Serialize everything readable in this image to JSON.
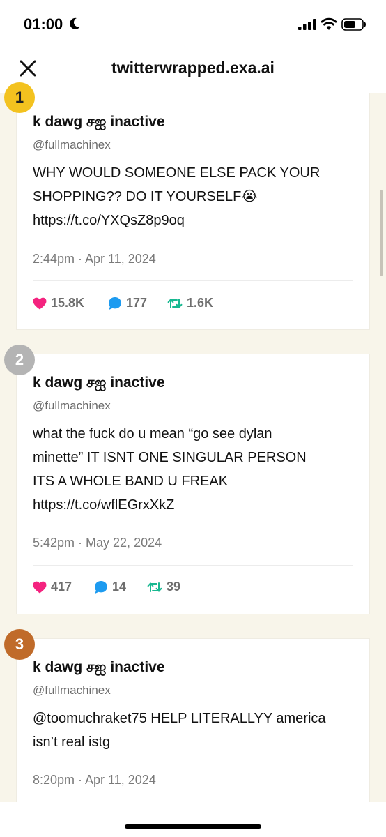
{
  "status_bar": {
    "time": "01:00"
  },
  "header": {
    "title": "twitterwrapped.exa.ai"
  },
  "tweets": [
    {
      "rank": "1",
      "name": "k dawg சஐ inactive",
      "handle": "@fullmachinex",
      "lines": [
        "WHY WOULD SOMEONE ELSE PACK YOUR",
        "SHOPPING?? DO IT YOURSELF😭",
        "https://t.co/YXQsZ8p9oq"
      ],
      "timestamp": "2:44pm · Apr 11, 2024",
      "likes": "15.8K",
      "replies": "177",
      "retweets": "1.6K"
    },
    {
      "rank": "2",
      "name": "k dawg சஐ inactive",
      "handle": "@fullmachinex",
      "lines": [
        "what the fuck do u mean “go see dylan",
        "minette” IT ISNT ONE SINGULAR PERSON",
        "ITS A WHOLE BAND U FREAK",
        "https://t.co/wflEGrxXkZ"
      ],
      "timestamp": "5:42pm · May 22, 2024",
      "likes": "417",
      "replies": "14",
      "retweets": "39"
    },
    {
      "rank": "3",
      "name": "k dawg சஐ inactive",
      "handle": "@fullmachinex",
      "lines": [
        "@toomuchraket75 HELP LITERALLYY america",
        "isn’t real istg"
      ],
      "timestamp": "8:20pm · Apr 11, 2024"
    }
  ],
  "icons": {
    "like": "heart-icon",
    "reply": "speech-bubble-icon",
    "retweet": "retweet-icon",
    "close": "close-icon"
  },
  "colors": {
    "background": "#f8f5ea",
    "like": "#f4237f",
    "reply": "#1d9bf0",
    "retweet": "#17b890",
    "rank_gold": "#f3c21f",
    "rank_silver": "#b4b4b4",
    "rank_bronze": "#c06b2a"
  }
}
